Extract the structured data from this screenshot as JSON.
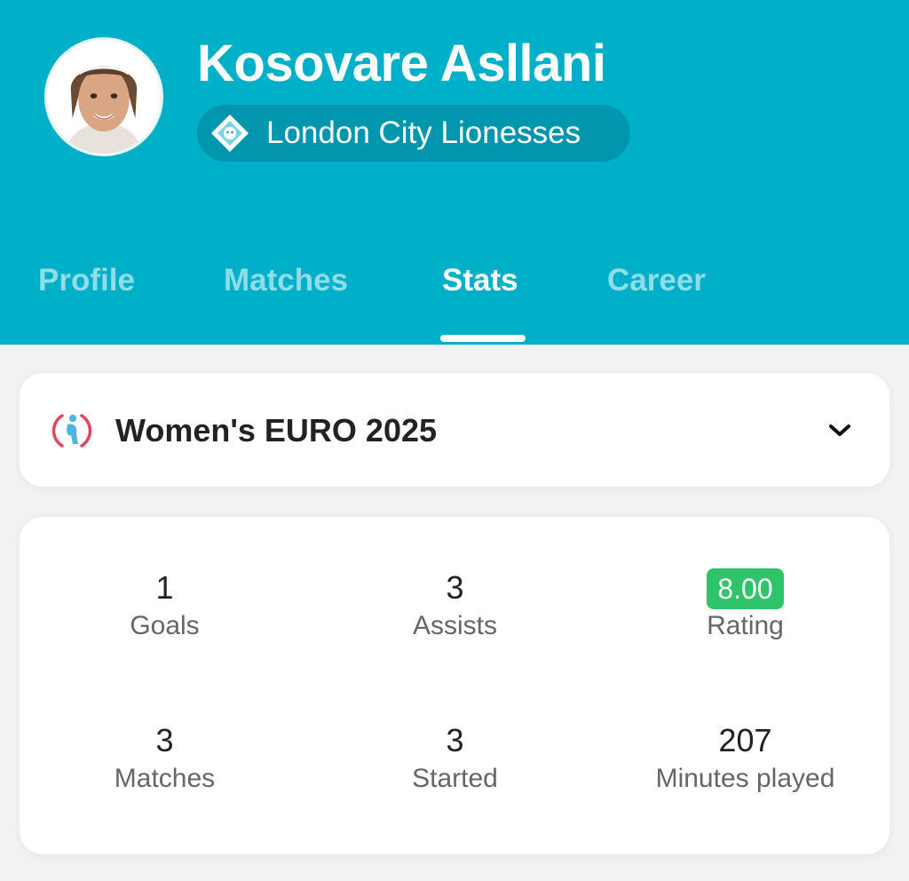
{
  "player": {
    "name": "Kosovare Asllani",
    "team": "London City Lionesses"
  },
  "tabs": [
    {
      "label": "Profile",
      "active": false
    },
    {
      "label": "Matches",
      "active": false
    },
    {
      "label": "Stats",
      "active": true
    },
    {
      "label": "Career",
      "active": false
    }
  ],
  "competition": {
    "name": "Women's EURO 2025",
    "icon": "uefa-womens-euro-icon",
    "dropdown_icon": "chevron-down-icon"
  },
  "stats": [
    {
      "value": "1",
      "label": "Goals"
    },
    {
      "value": "3",
      "label": "Assists"
    },
    {
      "value": "8.00",
      "label": "Rating"
    },
    {
      "value": "3",
      "label": "Matches"
    },
    {
      "value": "3",
      "label": "Started"
    },
    {
      "value": "207",
      "label": "Minutes played"
    }
  ],
  "colors": {
    "header": "#00afc8",
    "team_pill": "#0196ad",
    "tab_inactive": "#8fdde8",
    "rating_badge": "#2fc36a",
    "background": "#f2f2f2"
  }
}
